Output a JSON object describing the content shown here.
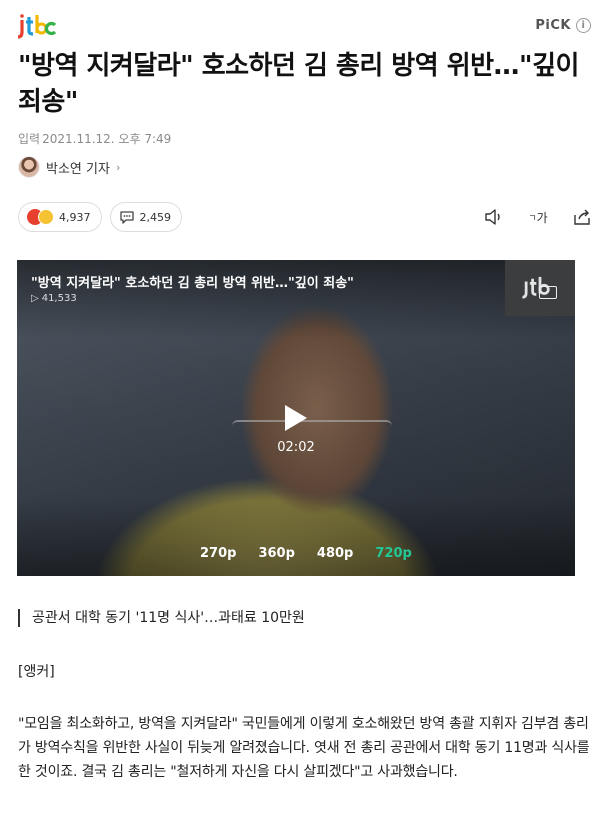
{
  "brand": {
    "logo_text": "jtbc",
    "pick_label": "PiCK",
    "info_glyph": "i"
  },
  "article": {
    "headline": "\"방역 지켜달라\" 호소하던 김 총리 방역 위반…\"깊이 죄송\"",
    "date_label": "입력",
    "date_value": "2021.11.12. 오후 7:49",
    "reporter": "박소연 기자",
    "reporter_chevron": "›"
  },
  "reactions": {
    "emotion_count": "4,937",
    "comment_count": "2,459"
  },
  "tools": {
    "font_size_label": "가"
  },
  "video": {
    "title": "\"방역 지켜달라\" 호소하던 김 총리 방역 위반…\"깊이 죄송\"",
    "views": "41,533",
    "duration": "02:02",
    "qualities": [
      "270p",
      "360p",
      "480p",
      "720p"
    ],
    "active_quality": "720p"
  },
  "body": {
    "summary": "공관서 대학 동기 '11명 식사'…과태료 10만원",
    "anchor": "[앵커]",
    "paragraph": "\"모임을 최소화하고, 방역을 지켜달라\" 국민들에게 이렇게 호소해왔던 방역 총괄 지휘자 김부겸 총리가 방역수칙을 위반한 사실이 뒤늦게 알려졌습니다. 엿새 전 총리 공관에서 대학 동기 11명과 식사를 한 것이죠. 결국 김 총리는 \"철저하게 자신을 다시 살피겠다\"고 사과했습니다."
  },
  "colors": {
    "accent_green": "#22c997",
    "logo_j": "#e8402e",
    "logo_t": "#1f9bd7",
    "logo_b": "#f2b900",
    "logo_c": "#36b24a"
  }
}
